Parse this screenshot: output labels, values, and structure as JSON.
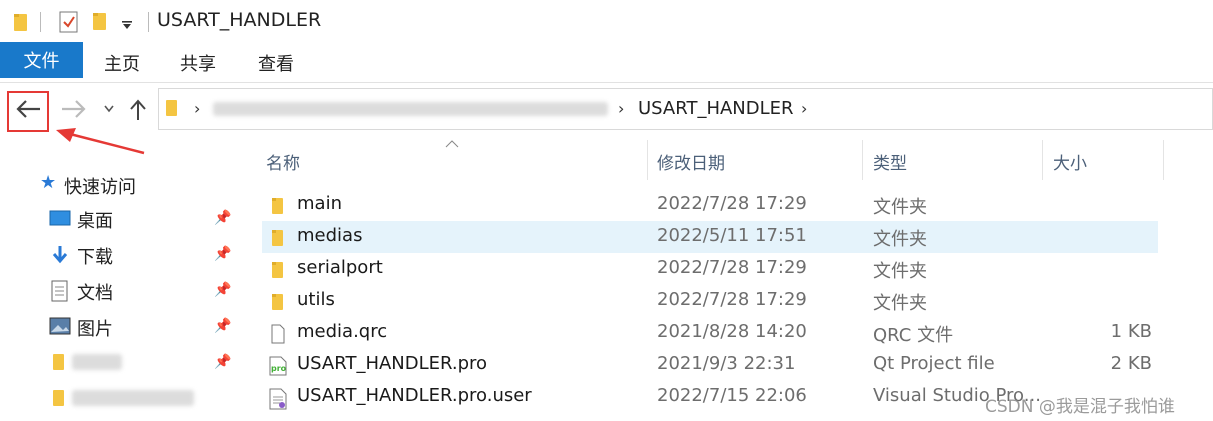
{
  "window": {
    "title": "USART_HANDLER"
  },
  "ribbon": {
    "tabs": [
      "文件",
      "主页",
      "共享",
      "查看"
    ]
  },
  "address": {
    "current": "USART_HANDLER"
  },
  "sidebar": {
    "quick_access": "快速访问",
    "items": [
      {
        "label": "桌面",
        "icon": "desktop-icon"
      },
      {
        "label": "下载",
        "icon": "download-icon"
      },
      {
        "label": "文档",
        "icon": "document-icon"
      },
      {
        "label": "图片",
        "icon": "picture-icon"
      }
    ]
  },
  "columns": {
    "name": "名称",
    "date": "修改日期",
    "type": "类型",
    "size": "大小"
  },
  "files": [
    {
      "name": "main",
      "date": "2022/7/28 17:29",
      "type": "文件夹",
      "size": "",
      "icon": "folder-icon"
    },
    {
      "name": "medias",
      "date": "2022/5/11 17:51",
      "type": "文件夹",
      "size": "",
      "icon": "folder-icon"
    },
    {
      "name": "serialport",
      "date": "2022/7/28 17:29",
      "type": "文件夹",
      "size": "",
      "icon": "folder-icon"
    },
    {
      "name": "utils",
      "date": "2022/7/28 17:29",
      "type": "文件夹",
      "size": "",
      "icon": "folder-icon"
    },
    {
      "name": "media.qrc",
      "date": "2021/8/28 14:20",
      "type": "QRC 文件",
      "size": "1 KB",
      "icon": "file-icon"
    },
    {
      "name": "USART_HANDLER.pro",
      "date": "2021/9/3 22:31",
      "type": "Qt Project file",
      "size": "2 KB",
      "icon": "pro-file-icon"
    },
    {
      "name": "USART_HANDLER.pro.user",
      "date": "2022/7/15 22:06",
      "type": "Visual Studio Pro...",
      "size": "",
      "icon": "user-file-icon"
    }
  ],
  "watermark": "CSDN @我是混子我怕谁",
  "colors": {
    "file_tab": "#1979ca",
    "selected_row": "#e5f3fb",
    "annotation": "#e53935",
    "folder": "#f4c542"
  }
}
